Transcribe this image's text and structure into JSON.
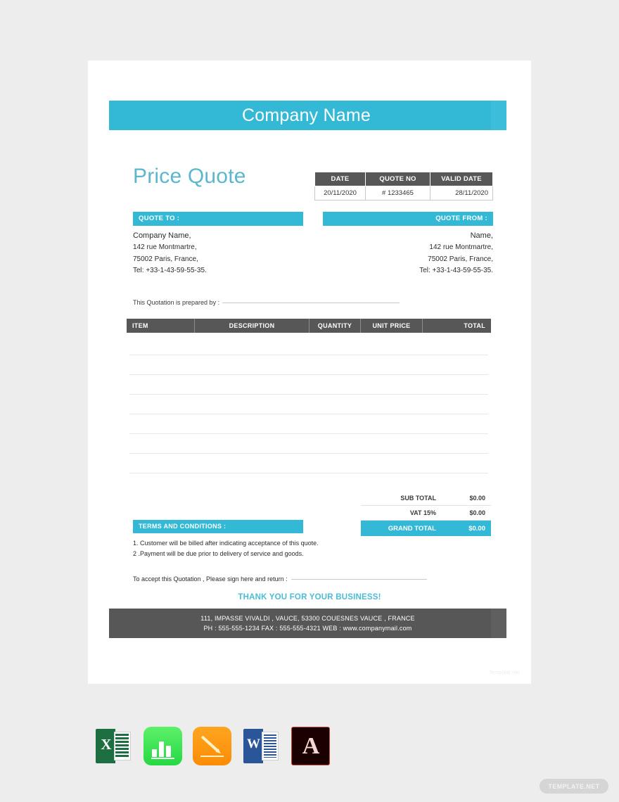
{
  "document": {
    "company_name": "Company Name",
    "title": "Price Quote"
  },
  "meta_table": {
    "headers": [
      "DATE",
      "QUOTE NO",
      "VALID DATE"
    ],
    "values": [
      "20/11/2020",
      "# 1233465",
      "28/11/2020"
    ]
  },
  "quote_to": {
    "label": "QUOTE TO :",
    "lines": [
      "Company Name,",
      "142 rue Montmartre,",
      "75002 Paris, France,",
      "Tel: +33-1-43-59-55-35."
    ]
  },
  "quote_from": {
    "label": "QUOTE FROM :",
    "lines": [
      "Name,",
      "142 rue Montmartre,",
      "75002 Paris, France,",
      "Tel: +33-1-43-59-55-35."
    ]
  },
  "prepared_by": {
    "label": "This Quotation is prepared by :",
    "value": ""
  },
  "items_table": {
    "headers": [
      "ITEM",
      "DESCRIPTION",
      "QUANTITY",
      "UNIT PRICE",
      "TOTAL"
    ],
    "empty_row_count": 7,
    "rows": []
  },
  "totals": {
    "sub_total_label": "SUB TOTAL",
    "sub_total_value": "$0.00",
    "vat_label": "VAT 15%",
    "vat_value": "$0.00",
    "grand_total_label": "GRAND TOTAL",
    "grand_total_value": "$0.00"
  },
  "terms": {
    "label": "TERMS AND CONDITIONS :",
    "items": [
      "1. Customer will be billed after indicating acceptance of this quote.",
      "2 .Payment will be due prior to delivery of service and goods."
    ]
  },
  "signature": {
    "label": "To accept this Quotation , Please sign here and return :",
    "value": ""
  },
  "thank_you": "THANK YOU FOR YOUR BUSINESS!",
  "footer": {
    "address": "111, IMPASSE VIVALDI , VAUCE, 53300 COUESNES VAUCE , FRANCE",
    "contact": "PH : 555-555-1234     FAX : 555-555-4321     WEB : www.companymail.com"
  },
  "watermark": "Template.net",
  "badge": "TEMPLATE.NET",
  "formats": [
    {
      "name": "excel-icon",
      "glyph": "X"
    },
    {
      "name": "numbers-icon",
      "glyph": ""
    },
    {
      "name": "pages-icon",
      "glyph": ""
    },
    {
      "name": "word-icon",
      "glyph": "W"
    },
    {
      "name": "pdf-icon",
      "glyph": "A"
    }
  ],
  "colors": {
    "accent": "#33b8d6",
    "dark": "#575757",
    "title": "#5cb7cc",
    "page_bg": "#ededed"
  }
}
